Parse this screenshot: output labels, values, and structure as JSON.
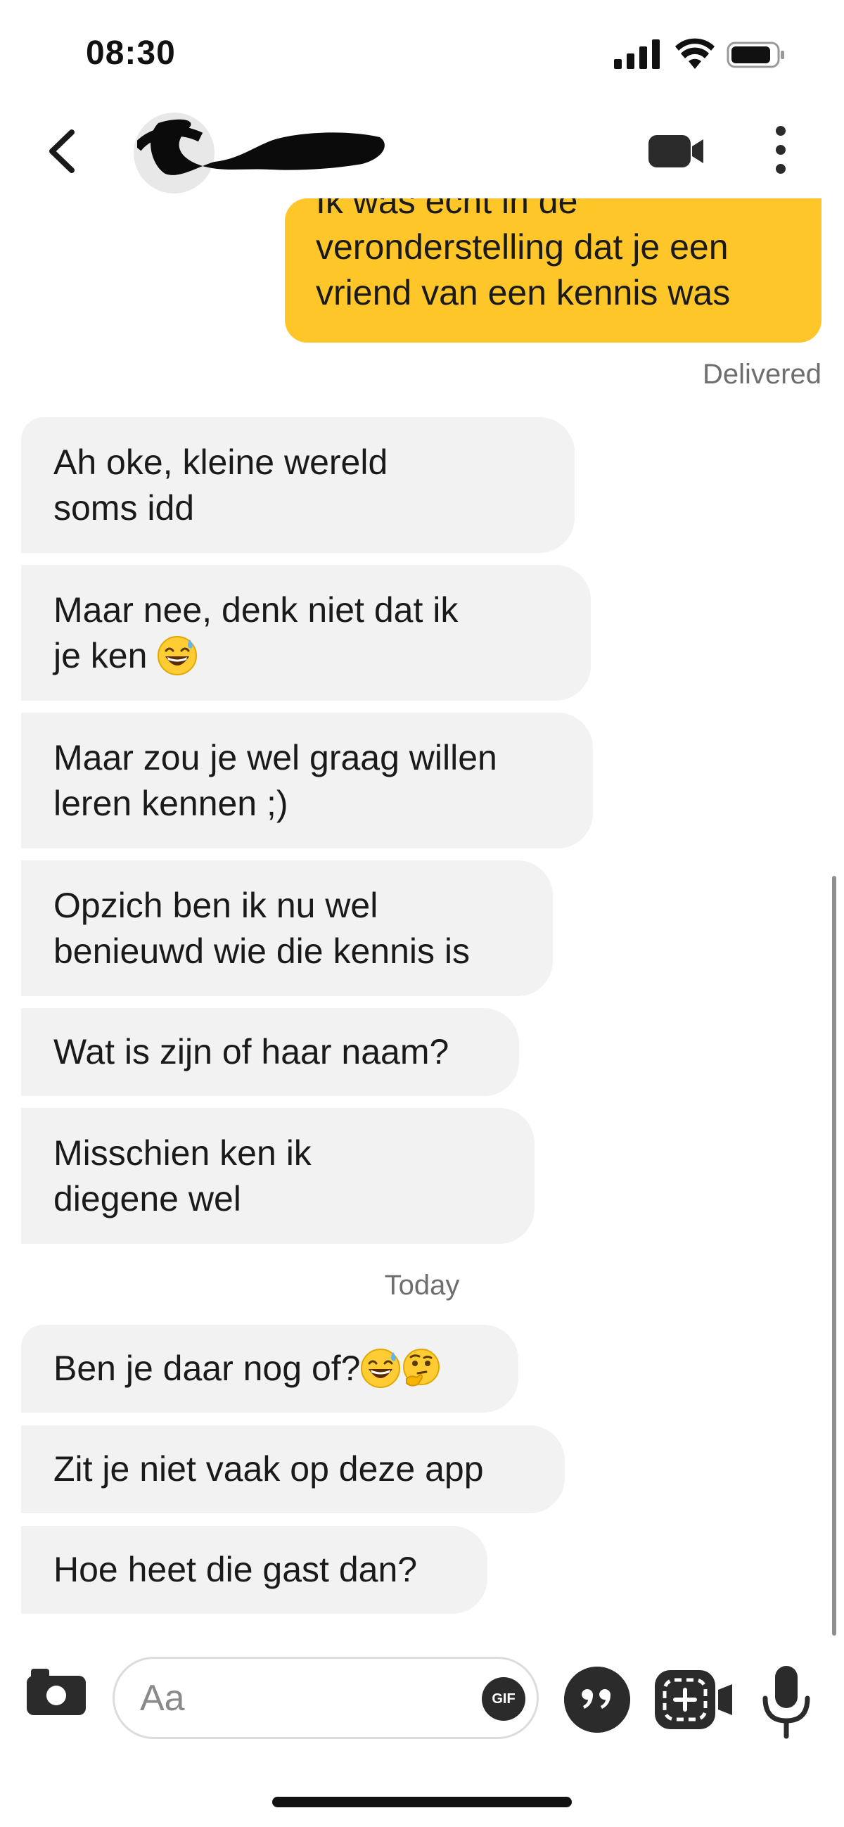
{
  "status_bar": {
    "time": "08:30"
  },
  "header": {
    "back_label": "back",
    "contact_name_redacted": true
  },
  "messages": {
    "outgoing_last": "Ik was echt in de\nveronderstelling dat je een\nvriend van een kennis was",
    "delivered_label": "Delivered",
    "incoming_1": [
      "Ah oke, kleine wereld\nsoms idd",
      "Maar nee, denk niet dat ik\nje ken",
      "Maar zou je wel graag willen\nleren kennen ;)",
      "Opzich ben ik nu wel\nbenieuwd wie die kennis is",
      "Wat is zijn of haar naam?",
      "Misschien ken ik\ndiegene wel"
    ],
    "today_label": "Today",
    "incoming_2": [
      "Ben je daar nog of?",
      "Zit je niet vaak op deze app",
      "Hoe heet die gast dan?"
    ]
  },
  "composer": {
    "placeholder": "Aa",
    "gif_label": "GIF"
  },
  "colors": {
    "accent": "#FFC629",
    "incoming_bubble": "#F2F2F2",
    "icon_dark": "#2B2B2B"
  }
}
